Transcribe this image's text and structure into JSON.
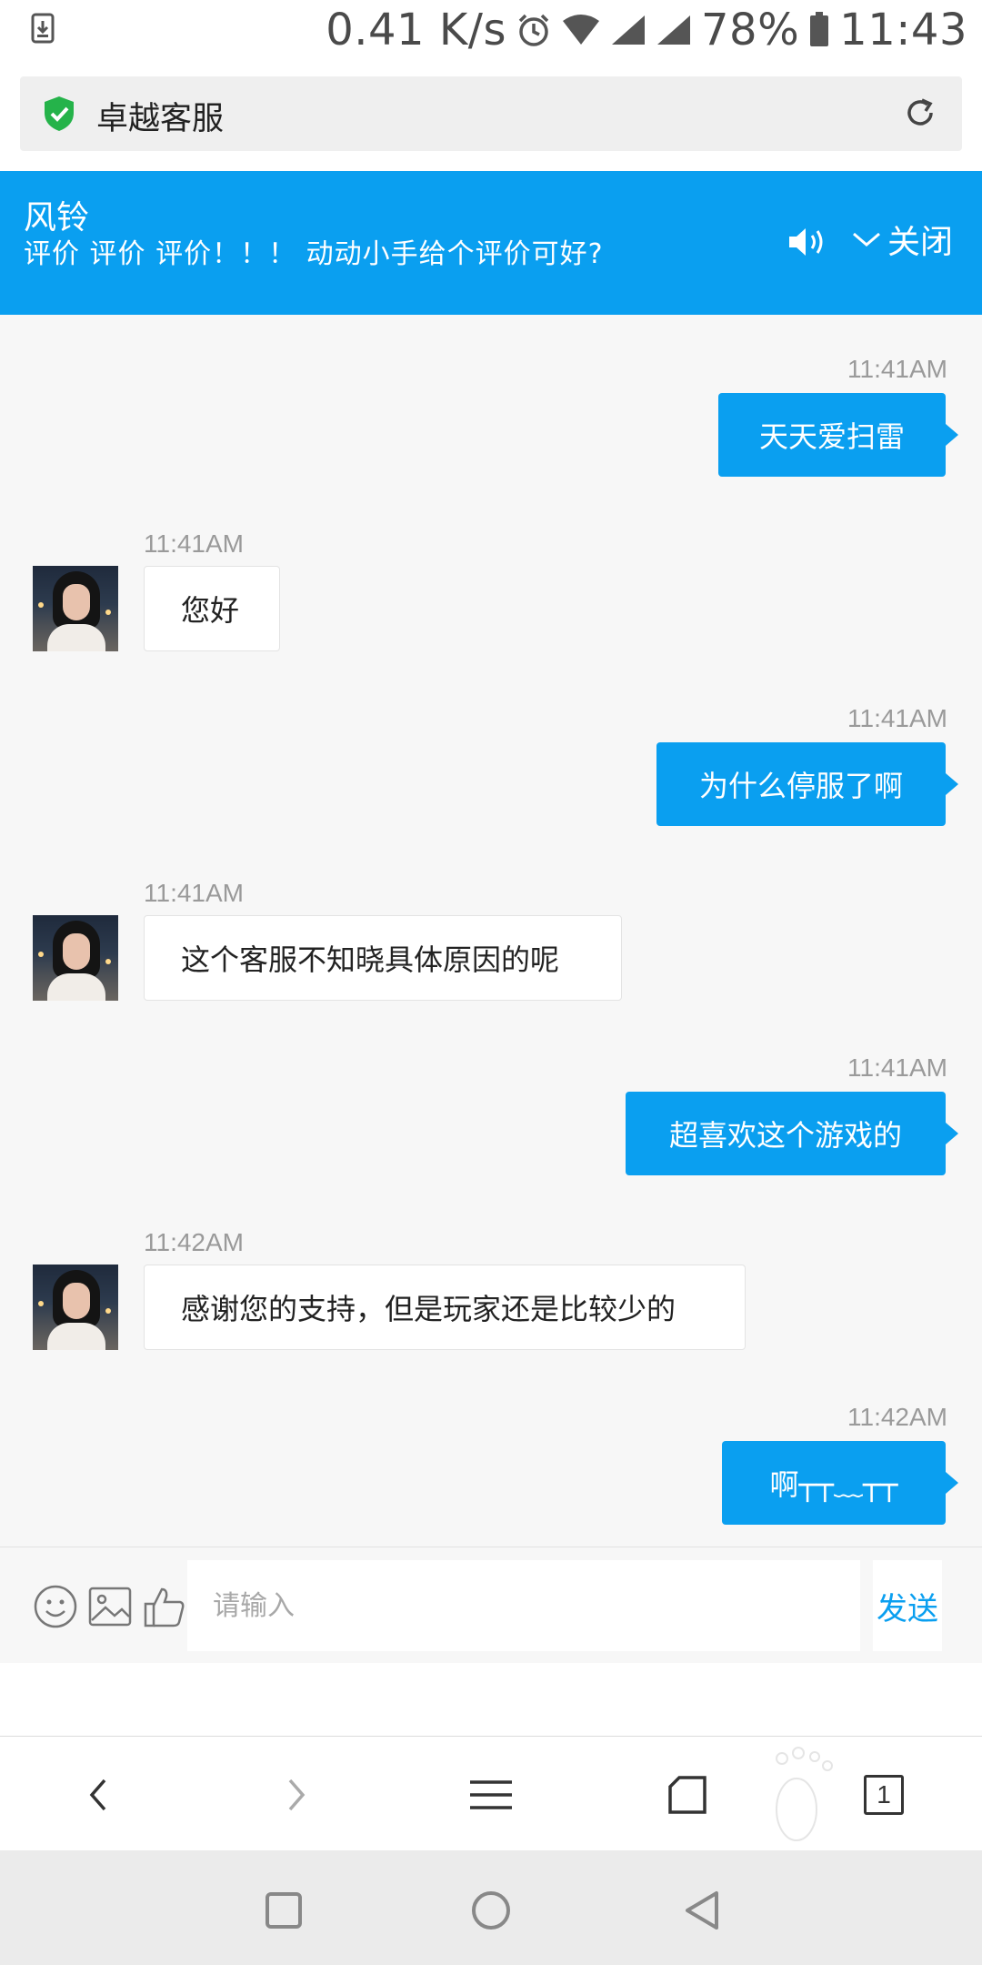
{
  "status_bar": {
    "speed": "0.41 K/s",
    "battery": "78%",
    "time": "11:43"
  },
  "url_bar": {
    "title": "卓越客服"
  },
  "banner": {
    "agent_name": "风铃",
    "notice": "评价 评价 评价！！！ 动动小手给个评价可好?",
    "close_label": "关闭"
  },
  "messages": [
    {
      "side": "out",
      "time": "11:41AM",
      "text": "天天爱扫雷"
    },
    {
      "side": "in",
      "time": "11:41AM",
      "text": "您好"
    },
    {
      "side": "out",
      "time": "11:41AM",
      "text": "为什么停服了啊"
    },
    {
      "side": "in",
      "time": "11:41AM",
      "text": "这个客服不知晓具体原因的呢"
    },
    {
      "side": "out",
      "time": "11:41AM",
      "text": "超喜欢这个游戏的"
    },
    {
      "side": "in",
      "time": "11:42AM",
      "text": "感谢您的支持，但是玩家还是比较少的"
    },
    {
      "side": "out",
      "time": "11:42AM",
      "text": "啊┬┬﹏┬┬"
    }
  ],
  "input": {
    "placeholder": "请输入",
    "send_label": "发送"
  },
  "browser": {
    "tab_count": "1"
  },
  "colors": {
    "accent": "#0a9ff0",
    "chat_bg": "#f7f7f7"
  },
  "icons": [
    "download-notification-icon",
    "alarm-icon",
    "wifi-icon",
    "signal-icon",
    "battery-icon",
    "shield-check-icon",
    "reload-icon",
    "speaker-icon",
    "chevron-down-icon",
    "emoji-icon",
    "image-icon",
    "thumbs-up-icon",
    "back-icon",
    "forward-icon",
    "menu-icon",
    "home-icon",
    "tabs-icon",
    "nav-recent-icon",
    "nav-home-icon",
    "nav-back-icon"
  ]
}
